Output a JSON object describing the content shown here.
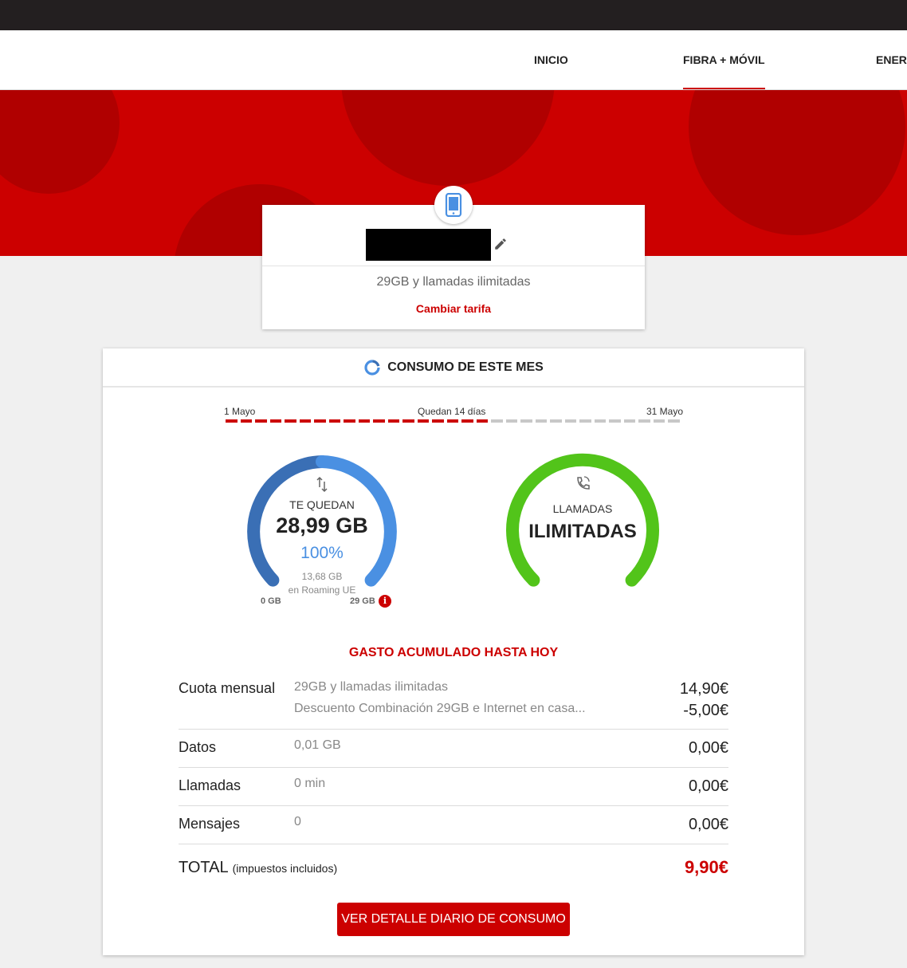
{
  "nav": {
    "items": [
      {
        "label": "INICIO",
        "active": false
      },
      {
        "label": "FIBRA + MÓVIL",
        "active": true
      },
      {
        "label": "ENERGÍA",
        "active": false
      }
    ]
  },
  "line": {
    "icon": "smartphone-icon",
    "name_redacted": true,
    "plan": "29GB y llamadas ilimitadas",
    "change_label": "Cambiar tarifa"
  },
  "consumption": {
    "title": "CONSUMO DE ESTE MES",
    "period": {
      "start": "1 Mayo",
      "remaining": "Quedan 14 días",
      "end": "31 Mayo",
      "days_elapsed": 18,
      "days_total": 31
    },
    "data": {
      "label": "TE QUEDAN",
      "value": "28,99 GB",
      "percent": "100%",
      "roaming_amount": "13,68 GB",
      "roaming_label": "en Roaming UE",
      "min_label": "0 GB",
      "max_label": "29 GB",
      "used_fraction": 0.0003
    },
    "calls": {
      "label": "LLAMADAS",
      "value": "ILIMITADAS"
    }
  },
  "spend": {
    "title": "GASTO ACUMULADO HASTA HOY",
    "rows": [
      {
        "label": "Cuota mensual",
        "items": [
          {
            "desc": "29GB y llamadas ilimitadas",
            "amount": "14,90€"
          },
          {
            "desc": "Descuento Combinación 29GB e Internet en casa...",
            "amount": "-5,00€"
          }
        ]
      },
      {
        "label": "Datos",
        "desc": "0,01 GB",
        "amount": "0,00€"
      },
      {
        "label": "Llamadas",
        "desc": "0 min",
        "amount": "0,00€"
      },
      {
        "label": "Mensajes",
        "desc": "0",
        "amount": "0,00€"
      }
    ],
    "total": {
      "label": "TOTAL",
      "note": "(impuestos incluidos)",
      "amount": "9,90€"
    }
  },
  "detail_button": "VER DETALLE DIARIO DE CONSUMO",
  "colors": {
    "brand_red": "#cc0000",
    "data_blue": "#4a90e2",
    "data_blue_dark": "#3a6fb5",
    "calls_green": "#52c41a"
  }
}
